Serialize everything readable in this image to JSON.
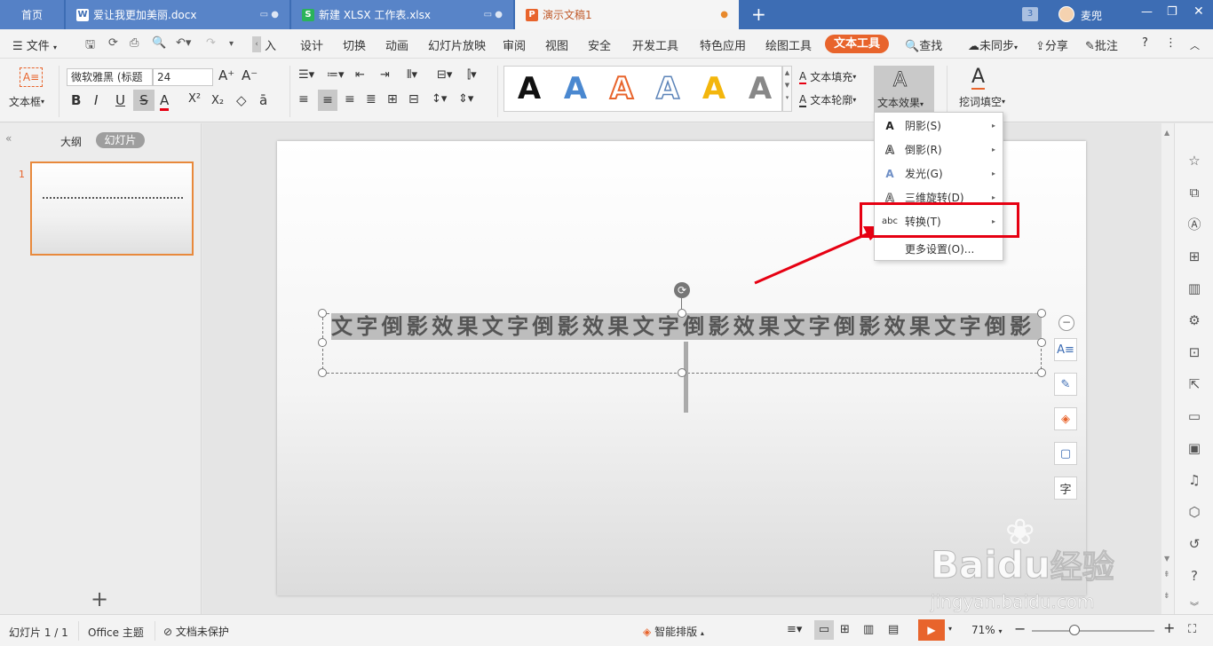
{
  "tabs": {
    "home": "首页",
    "doc1": "爱让我更加美丽.docx",
    "doc2": "新建 XLSX 工作表.xlsx",
    "doc3": "演示文稿1",
    "badge": "3",
    "user": "麦兜"
  },
  "menu": {
    "file": "文件",
    "items": [
      "插入",
      "设计",
      "切换",
      "动画",
      "幻灯片放映",
      "审阅",
      "视图",
      "安全",
      "开发工具",
      "特色应用",
      "绘图工具"
    ],
    "active": "文本工具",
    "search": "查找",
    "sync": "未同步",
    "share": "分享",
    "comment": "批注",
    "help": "?"
  },
  "ribbon": {
    "textbox": "文本框",
    "font_name": "微软雅黑 (标题",
    "font_size": "24",
    "text_fill": "文本填充",
    "text_outline": "文本轮廓",
    "text_effect": "文本效果",
    "cloze": "挖词填空",
    "style_letter": "A"
  },
  "left": {
    "outline": "大纲",
    "slides": "幻灯片",
    "slide_num": "1",
    "add": "+"
  },
  "slide": {
    "text": "文字倒影效果文字倒影效果文字倒影效果文字倒影效果文字倒影"
  },
  "dropdown": {
    "items": [
      {
        "label": "阴影(S)",
        "icon": "A"
      },
      {
        "label": "倒影(R)",
        "icon": "A"
      },
      {
        "label": "发光(G)",
        "icon": "A"
      },
      {
        "label": "三维旋转(D)",
        "icon": "A"
      },
      {
        "label": "转换(T)",
        "icon": "abc"
      }
    ],
    "more": "更多设置(O)..."
  },
  "status": {
    "slide_count": "幻灯片 1 / 1",
    "theme": "Office 主题",
    "protect": "文档未保护",
    "smart": "智能排版",
    "zoom": "71%"
  },
  "watermark": {
    "brand": "Bai",
    "brand2": "du",
    "cn": "经验",
    "url": "jingyan.baidu.com"
  },
  "colors": {
    "tabbar": "#3d6db4",
    "accent": "#e8642c",
    "highlight": "#e60012"
  }
}
